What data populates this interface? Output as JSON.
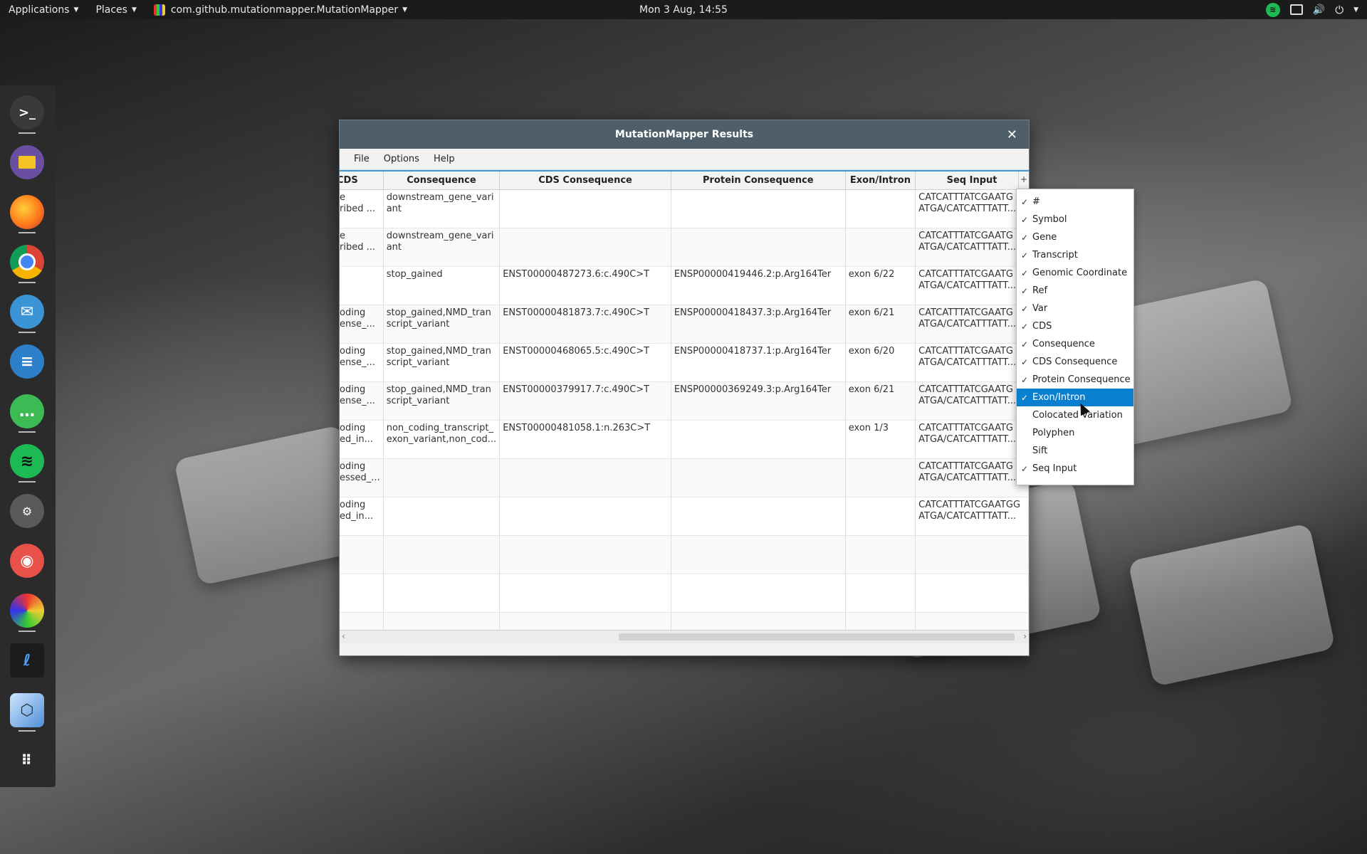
{
  "topbar": {
    "applications": "Applications",
    "places": "Places",
    "app_name": "com.github.mutationmapper.MutationMapper",
    "clock": "Mon  3 Aug, 14:55"
  },
  "dock": {
    "items": [
      "terminal-icon",
      "files-icon",
      "firefox-icon",
      "chrome-icon",
      "mail-icon",
      "text-editor-icon",
      "chat-icon",
      "spotify-icon",
      "settings-icon",
      "camera-icon",
      "mutationmapper-icon",
      "dna-editor-icon",
      "cube-icon",
      "app-grid-icon"
    ]
  },
  "window": {
    "title": "MutationMapper Results",
    "menu": {
      "file": "File",
      "options": "Options",
      "help": "Help"
    },
    "table": {
      "headers": [
        "CDS",
        "Consequence",
        "CDS Consequence",
        "Protein Consequence",
        "Exon/Intron",
        "Seq Input"
      ],
      "rows": [
        [
          "e\nribed ...",
          "downstream_gene_vari\nant",
          "",
          "",
          "",
          "CATCATTTATCGAATG\nATGA/CATCATTTATT..."
        ],
        [
          "e\nribed ...",
          "downstream_gene_vari\nant",
          "",
          "",
          "",
          "CATCATTTATCGAATG\nATGA/CATCATTTATT..."
        ],
        [
          "",
          "stop_gained",
          "ENST00000487273.6:c.490C>T",
          "ENSP00000419446.2:p.Arg164Ter",
          "exon 6/22",
          "CATCATTTATCGAATG\nATGA/CATCATTTATT..."
        ],
        [
          "oding\nense_...",
          "stop_gained,NMD_tran\nscript_variant",
          "ENST00000481873.7:c.490C>T",
          "ENSP00000418437.3:p.Arg164Ter",
          "exon 6/21",
          "CATCATTTATCGAATG\nATGA/CATCATTTATT..."
        ],
        [
          "oding\nense_...",
          "stop_gained,NMD_tran\nscript_variant",
          "ENST00000468065.5:c.490C>T",
          "ENSP00000418737.1:p.Arg164Ter",
          "exon 6/20",
          "CATCATTTATCGAATG\nATGA/CATCATTTATT..."
        ],
        [
          "oding\nense_...",
          "stop_gained,NMD_tran\nscript_variant",
          "ENST00000379917.7:c.490C>T",
          "ENSP00000369249.3:p.Arg164Ter",
          "exon 6/21",
          "CATCATTTATCGAATG\nATGA/CATCATTTATT..."
        ],
        [
          "oding\ned_in...",
          "non_coding_transcript_\nexon_variant,non_cod...",
          "ENST00000481058.1:n.263C>T",
          "",
          "exon 1/3",
          "CATCATTTATCGAATG\nATGA/CATCATTTATT..."
        ],
        [
          "oding\nessed_...",
          "",
          "",
          "",
          "",
          "CATCATTTATCGAATG\nATGA/CATCATTTATT..."
        ],
        [
          "oding\ned_in...",
          "",
          "",
          "",
          "",
          "CATCATTTATCGAATGG\nATGA/CATCATTTATT..."
        ],
        [
          "",
          "",
          "",
          "",
          "",
          ""
        ],
        [
          "",
          "",
          "",
          "",
          "",
          ""
        ],
        [
          "",
          "",
          "",
          "",
          "",
          ""
        ],
        [
          "",
          "",
          "",
          "",
          "",
          ""
        ]
      ]
    }
  },
  "column_menu": {
    "items": [
      {
        "label": "#",
        "checked": true
      },
      {
        "label": "Symbol",
        "checked": true
      },
      {
        "label": "Gene",
        "checked": true
      },
      {
        "label": "Transcript",
        "checked": true
      },
      {
        "label": "Genomic Coordinate",
        "checked": true
      },
      {
        "label": "Ref",
        "checked": true
      },
      {
        "label": "Var",
        "checked": true
      },
      {
        "label": "CDS",
        "checked": true
      },
      {
        "label": "Consequence",
        "checked": true
      },
      {
        "label": "CDS Consequence",
        "checked": true
      },
      {
        "label": "Protein Consequence",
        "checked": true
      },
      {
        "label": "Exon/Intron",
        "checked": true,
        "selected": true
      },
      {
        "label": "Colocated Variation",
        "checked": false
      },
      {
        "label": "Polyphen",
        "checked": false
      },
      {
        "label": "Sift",
        "checked": false
      },
      {
        "label": "Seq Input",
        "checked": true
      }
    ],
    "check_glyph": "✓"
  },
  "colors": {
    "accent": "#0a7fd0",
    "titlebar": "#4f5f69",
    "spotify": "#1db954"
  }
}
